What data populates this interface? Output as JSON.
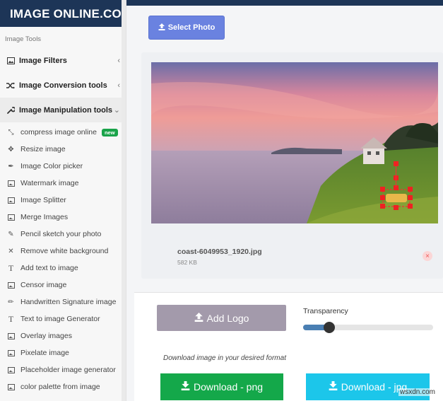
{
  "sidebar": {
    "logo": "IMAGE ONLINE.CO",
    "section_label": "Image Tools",
    "menus": [
      {
        "label": "Image Filters",
        "icon": "image-icon",
        "chevron": "‹"
      },
      {
        "label": "Image Conversion tools",
        "icon": "shuffle-icon",
        "chevron": "‹"
      },
      {
        "label": "Image Manipulation tools",
        "icon": "wrench-icon",
        "chevron": "⌄"
      }
    ],
    "items": [
      {
        "label": "compress image online",
        "icon": "compress-icon",
        "badge": "new"
      },
      {
        "label": "Resize image",
        "icon": "arrows-move-icon"
      },
      {
        "label": "Image Color picker",
        "icon": "eyedropper-icon"
      },
      {
        "label": "Watermark image",
        "icon": "image-icon"
      },
      {
        "label": "Image Splitter",
        "icon": "image-icon"
      },
      {
        "label": "Merge Images",
        "icon": "image-icon"
      },
      {
        "label": "Pencil sketch your photo",
        "icon": "edit-icon"
      },
      {
        "label": "Remove white background",
        "icon": "close-icon"
      },
      {
        "label": "Add text to image",
        "icon": "text-icon"
      },
      {
        "label": "Censor image",
        "icon": "image-icon"
      },
      {
        "label": "Handwritten Signature image",
        "icon": "pencil-icon"
      },
      {
        "label": "Text to image Generator",
        "icon": "text-icon"
      },
      {
        "label": "Overlay images",
        "icon": "image-icon"
      },
      {
        "label": "Pixelate image",
        "icon": "image-icon"
      },
      {
        "label": "Placeholder image generator",
        "icon": "image-icon"
      },
      {
        "label": "color palette from image",
        "icon": "image-icon"
      }
    ]
  },
  "main": {
    "select_photo": "Select Photo",
    "file": {
      "name": "coast-6049953_1920.jpg",
      "size": "582 KB"
    },
    "add_logo": "Add Logo",
    "transparency_label": "Transparency",
    "transparency_value": 0.2,
    "download_caption": "Download image in your desired format",
    "download_png": "Download - png",
    "download_jpg": "Download - jpg"
  },
  "watermark": "wsxdn.com",
  "colors": {
    "brand": "#1d3557",
    "select_btn": "#6a82e0",
    "png_btn": "#14a84a",
    "jpg_btn": "#1cc6ea",
    "logo_btn": "#a39aab",
    "badge": "#1aa34a"
  }
}
